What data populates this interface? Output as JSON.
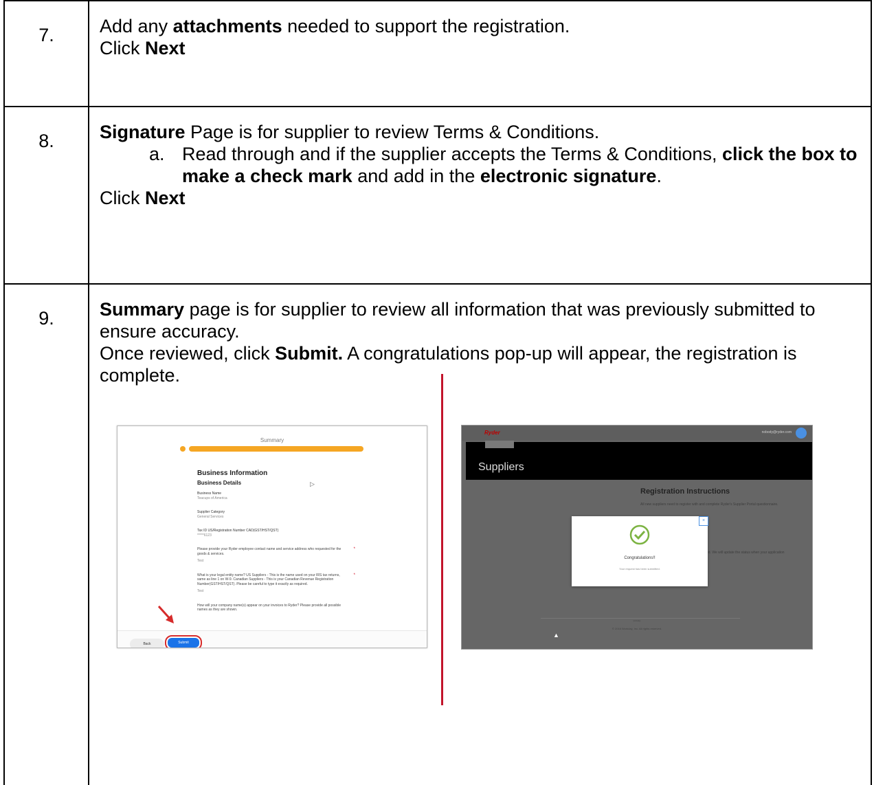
{
  "steps": [
    {
      "number": "7.",
      "line1_pre": "Add any ",
      "line1_bold": "attachments",
      "line1_post": " needed to support the registration.",
      "click_pre": "Click ",
      "click_bold": "Next"
    },
    {
      "number": "8.",
      "line1_bold": "Signature",
      "line1_post": " Page is for supplier to review Terms & Conditions.",
      "sub_letter": "a.",
      "sub_text1": "Read through and if the supplier accepts the Terms & Conditions, ",
      "sub_bold1": "click the box to make a check mark",
      "sub_text2": " and add in the ",
      "sub_bold2": "electronic signature",
      "sub_text3": ".",
      "click_pre": "Click ",
      "click_bold": "Next"
    },
    {
      "number": "9.",
      "line1_bold": "Summary",
      "line1_post": " page is for supplier to review all information that was previously submitted to ensure accuracy.",
      "line2_pre": "Once reviewed, click ",
      "line2_bold": "Submit.",
      "line2_post": " A congratulations pop-up will appear, the registration is complete."
    }
  ],
  "screenshot_summary": {
    "title": "Summary",
    "heading": "Business Information",
    "subheading": "Business Details",
    "fields": [
      {
        "label": "Business Name",
        "value": "Teacups of America"
      },
      {
        "label": "Supplier Category",
        "value": "General Services"
      },
      {
        "label": "Tax ID US/Registration Number CAD(GST/HST/QST)",
        "value": "*****6123"
      }
    ],
    "q1": "Please provide your Ryder employee contact name and service address who requested for the goods & services.",
    "q1_value": "Test",
    "q2": "What is your legal entity name?  US Suppliers - This is the name used on your IRS tax returns, same as line 1 on W-9. Canadian Suppliers - This is your Canadian Revenue Registration Number(GST/HST/QST). Please be careful to type it exactly as required.",
    "q2_value": "Test",
    "q3": "How will your company name(s) appear on your invoices to Ryder?  Please provide all possible names as they are shown.",
    "back": "Back",
    "submit": "Submit",
    "required_mark": "*"
  },
  "screenshot_congrats": {
    "logo": "Ryder",
    "email": "nobody@ryder.com",
    "page_title": "Suppliers",
    "reg_heading": "Registration Instructions",
    "reg_text": "All new suppliers need to register with and complete Ryder's Supplier Portal questionnaire.",
    "side_text": "ed. We will update the status when your application",
    "modal_close": "×",
    "modal_title": "Congratulations!!",
    "modal_text": "Your request has been submitted.",
    "footer_small": "workday",
    "footer": "© 2018 Workday, Inc. All rights reserved."
  },
  "colors": {
    "divider": "#c2132a",
    "progress": "#f5a623",
    "submit_button": "#1a73e8",
    "highlight": "#d62b2b",
    "check": "#7cb342"
  }
}
